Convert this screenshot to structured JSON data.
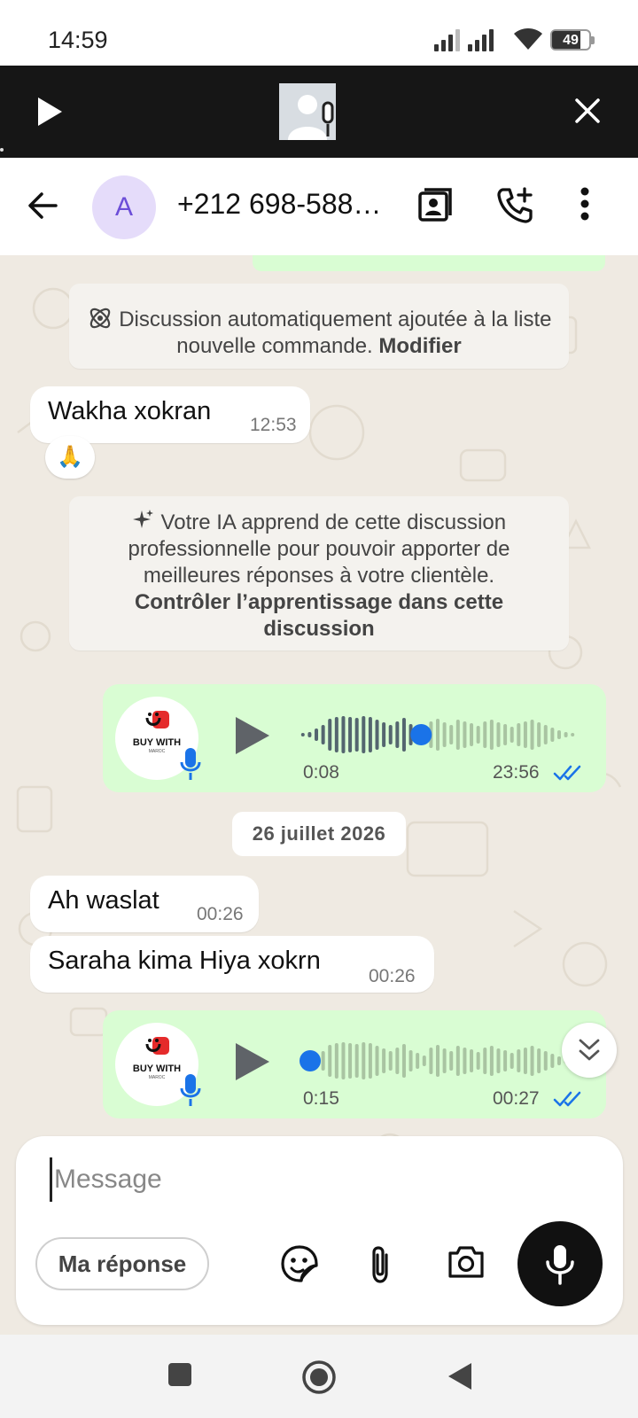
{
  "status_bar": {
    "time": "14:59",
    "battery": "49",
    "icons": [
      "signal-icon",
      "signal-icon",
      "wifi-icon",
      "battery-icon"
    ]
  },
  "media_bar": {
    "icons": [
      "play-icon",
      "voice-note-thumbnail",
      "close-icon"
    ]
  },
  "header": {
    "avatar_letter": "A",
    "contact": "+212 698-588…",
    "icons": [
      "back-arrow-icon",
      "contact-card-icon",
      "add-call-icon",
      "more-vert-icon"
    ]
  },
  "messages": {
    "system_1": {
      "text": "Discussion automatiquement ajoutée à la liste nouvelle commande.",
      "link": "Modifier"
    },
    "in_1": {
      "text": "Wakha xokran",
      "time": "12:53",
      "reaction": "🙏"
    },
    "system_2": {
      "text": "Votre IA apprend de cette discussion professionnelle pour pouvoir apporter de meilleures réponses à votre clientèle.",
      "link": "Contrôler l’apprentissage dans cette discussion"
    },
    "voice_1": {
      "duration": "0:08",
      "time": "23:56",
      "progress": 0.44,
      "brand": "BUY WITH",
      "brand_sub": "MAROC"
    },
    "date_chip": "26 juillet 2026",
    "in_2": {
      "text": "Ah waslat",
      "time": "00:26"
    },
    "in_3": {
      "text": "Saraha kima Hiya xokrn",
      "time": "00:26"
    },
    "voice_2": {
      "duration": "0:15",
      "time": "00:27",
      "progress": 0.0,
      "brand": "BUY WITH",
      "brand_sub": "MAROC"
    }
  },
  "composer": {
    "placeholder": "Message",
    "quick_reply": "Ma réponse",
    "icons": [
      "sticker-icon",
      "attach-icon",
      "camera-icon",
      "mic-icon"
    ]
  },
  "nav_bar": {
    "icons": [
      "recents-icon",
      "home-icon",
      "back-icon"
    ]
  },
  "colors": {
    "outgoing_bubble": "#d9fdd3",
    "chat_background": "#efeae2",
    "accent_blue": "#1a73e8",
    "read_ticks": "#53bdeb"
  }
}
